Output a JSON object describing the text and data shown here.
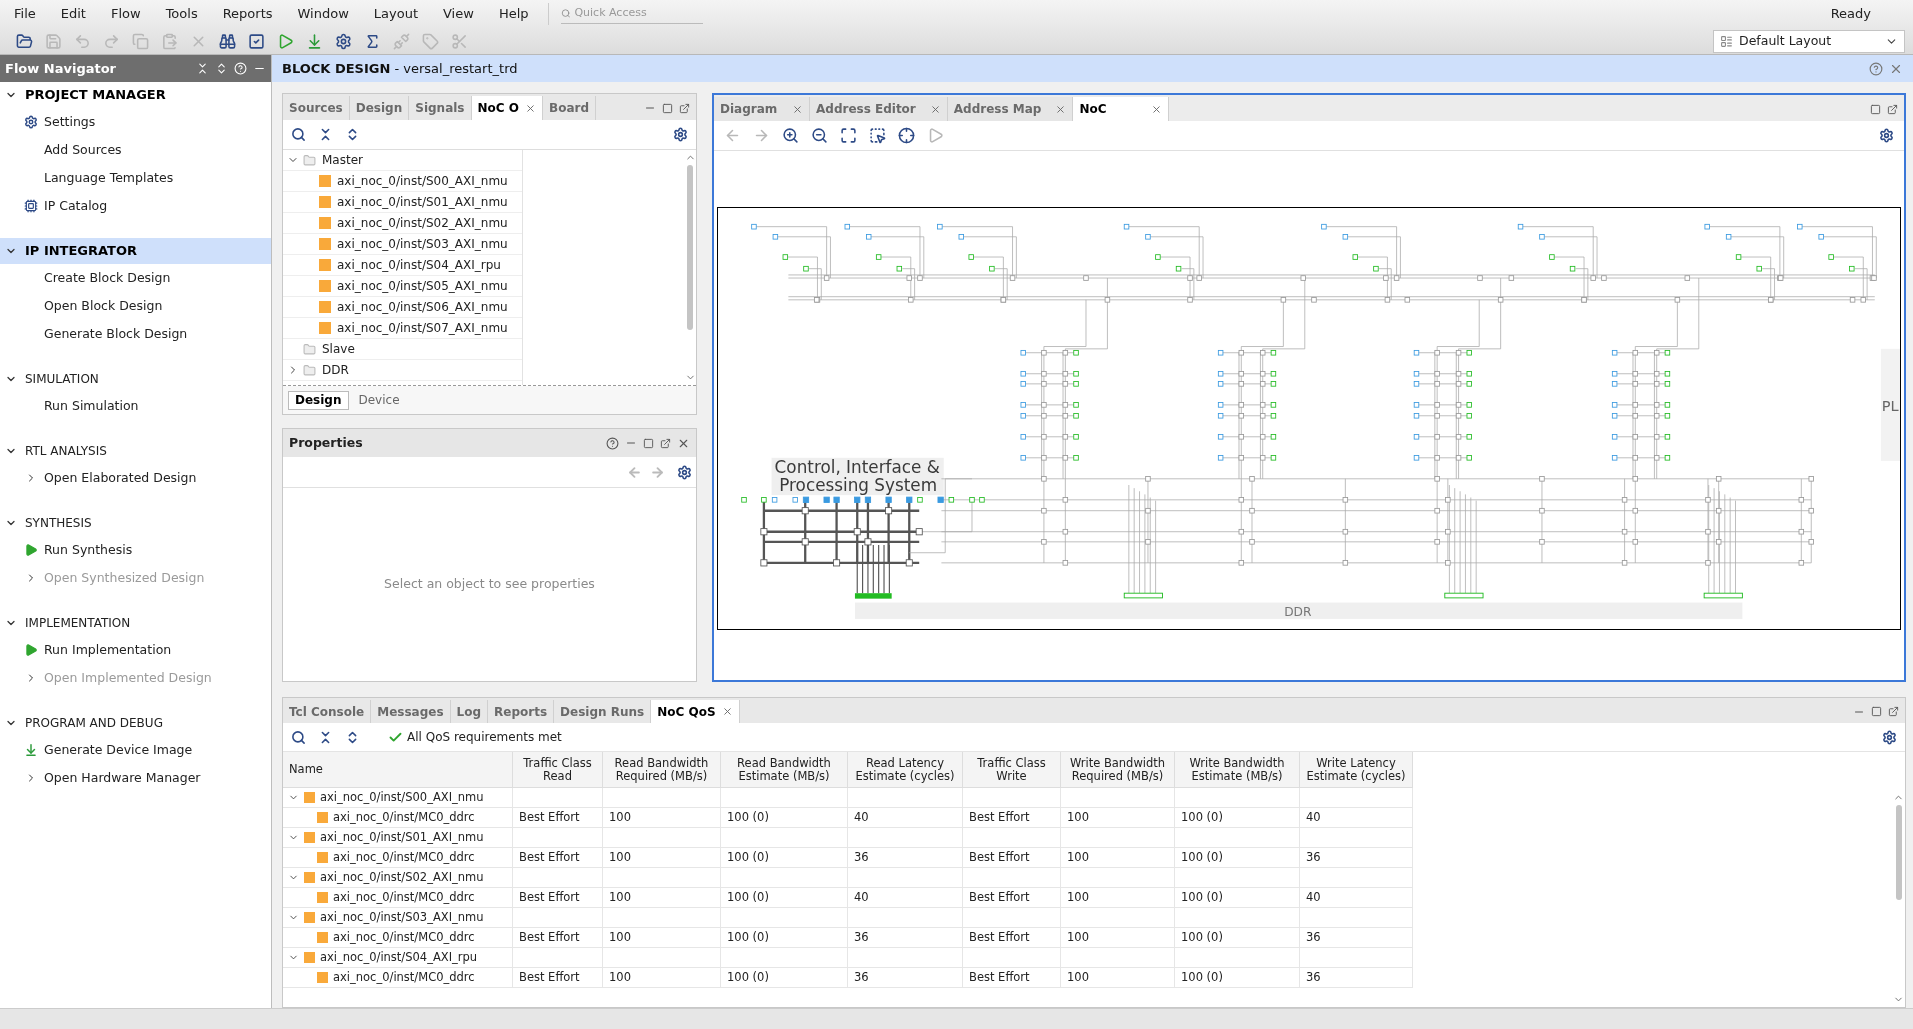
{
  "menu": [
    "File",
    "Edit",
    "Flow",
    "Tools",
    "Reports",
    "Window",
    "Layout",
    "View",
    "Help"
  ],
  "quick_access": {
    "placeholder": "Quick Access"
  },
  "status": "Ready",
  "toolbar": [
    {
      "kind": "open",
      "disabled": false
    },
    {
      "kind": "save",
      "disabled": true
    },
    {
      "kind": "undo",
      "disabled": true
    },
    {
      "kind": "redo",
      "disabled": true
    },
    {
      "kind": "copy",
      "disabled": true
    },
    {
      "kind": "paste",
      "disabled": true
    },
    {
      "kind": "delete",
      "disabled": true
    },
    {
      "kind": "find",
      "disabled": false
    },
    {
      "kind": "check",
      "disabled": false
    },
    {
      "kind": "run",
      "disabled": false
    },
    {
      "kind": "bitstream",
      "disabled": false
    },
    {
      "kind": "settings",
      "disabled": false
    },
    {
      "kind": "sigma",
      "disabled": false
    },
    {
      "kind": "unplug",
      "disabled": true
    },
    {
      "kind": "tag",
      "disabled": true
    },
    {
      "kind": "cut",
      "disabled": true
    }
  ],
  "layout_select": "Default Layout",
  "flow_navigator": {
    "title": "Flow Navigator",
    "sections": [
      {
        "title": "PROJECT MANAGER",
        "kind": "major",
        "selected": false,
        "items": [
          {
            "label": "Settings",
            "kind": "gear",
            "disabled": false
          },
          {
            "label": "Add Sources",
            "kind": "plain",
            "disabled": false
          },
          {
            "label": "Language Templates",
            "kind": "plain",
            "disabled": false
          },
          {
            "label": "IP Catalog",
            "kind": "chip",
            "disabled": false
          }
        ]
      },
      {
        "title": "IP INTEGRATOR",
        "kind": "major",
        "selected": true,
        "items": [
          {
            "label": "Create Block Design",
            "kind": "plain",
            "disabled": false
          },
          {
            "label": "Open Block Design",
            "kind": "plain",
            "disabled": false
          },
          {
            "label": "Generate Block Design",
            "kind": "plain",
            "disabled": false
          }
        ]
      },
      {
        "title": "SIMULATION",
        "kind": "minor",
        "selected": false,
        "items": [
          {
            "label": "Run Simulation",
            "kind": "plain",
            "disabled": false
          }
        ]
      },
      {
        "title": "RTL ANALYSIS",
        "kind": "minor",
        "selected": false,
        "items": [
          {
            "label": "Open Elaborated Design",
            "kind": "expandable",
            "disabled": false
          }
        ]
      },
      {
        "title": "SYNTHESIS",
        "kind": "minor",
        "selected": false,
        "items": [
          {
            "label": "Run Synthesis",
            "kind": "play",
            "disabled": false
          },
          {
            "label": "Open Synthesized Design",
            "kind": "expandable",
            "disabled": true
          }
        ]
      },
      {
        "title": "IMPLEMENTATION",
        "kind": "minor",
        "selected": false,
        "items": [
          {
            "label": "Run Implementation",
            "kind": "play",
            "disabled": false
          },
          {
            "label": "Open Implemented Design",
            "kind": "expandable",
            "disabled": true
          }
        ]
      },
      {
        "title": "PROGRAM AND DEBUG",
        "kind": "minor",
        "selected": false,
        "items": [
          {
            "label": "Generate Device Image",
            "kind": "bitstream",
            "disabled": false
          },
          {
            "label": "Open Hardware Manager",
            "kind": "expandable",
            "disabled": false
          }
        ]
      }
    ]
  },
  "design_header": {
    "title": "BLOCK DESIGN",
    "subtitle": "- versal_restart_trd"
  },
  "sources_panel": {
    "tabs": [
      {
        "label": "Sources",
        "selected": false,
        "closable": false
      },
      {
        "label": "Design",
        "selected": false,
        "closable": false
      },
      {
        "label": "Signals",
        "selected": false,
        "closable": false
      },
      {
        "label": "NoC O",
        "selected": true,
        "closable": true
      },
      {
        "label": "Board",
        "selected": false,
        "closable": false
      }
    ],
    "tree": [
      {
        "label": "Master",
        "expanded": true,
        "children": [
          {
            "label": "axi_noc_0/inst/S00_AXI_nmu"
          },
          {
            "label": "axi_noc_0/inst/S01_AXI_nmu"
          },
          {
            "label": "axi_noc_0/inst/S02_AXI_nmu"
          },
          {
            "label": "axi_noc_0/inst/S03_AXI_nmu"
          },
          {
            "label": "axi_noc_0/inst/S04_AXI_rpu"
          },
          {
            "label": "axi_noc_0/inst/S05_AXI_nmu"
          },
          {
            "label": "axi_noc_0/inst/S06_AXI_nmu"
          },
          {
            "label": "axi_noc_0/inst/S07_AXI_nmu"
          }
        ]
      },
      {
        "label": "Slave"
      },
      {
        "label": "DDR",
        "expanded": false
      }
    ],
    "view_tabs": [
      {
        "label": "Design",
        "selected": true
      },
      {
        "label": "Device",
        "selected": false
      }
    ]
  },
  "properties": {
    "title": "Properties",
    "message": "Select an object to see properties"
  },
  "diagram": {
    "tabs": [
      {
        "label": "Diagram",
        "selected": false
      },
      {
        "label": "Address Editor",
        "selected": false
      },
      {
        "label": "Address Map",
        "selected": false
      },
      {
        "label": "NoC",
        "selected": true
      }
    ],
    "toolbar": [
      {
        "kind": "back",
        "disabled": true
      },
      {
        "kind": "forward",
        "disabled": true
      },
      {
        "kind": "zoom_in",
        "disabled": false
      },
      {
        "kind": "zoom_out",
        "disabled": false
      },
      {
        "kind": "fit",
        "disabled": false
      },
      {
        "kind": "zoom_area",
        "disabled": false
      },
      {
        "kind": "locate",
        "disabled": false
      },
      {
        "kind": "run",
        "disabled": true
      }
    ],
    "labels": [
      {
        "kind": "cips",
        "lines": [
          "Control, Interface &",
          "Processing System"
        ]
      },
      {
        "kind": "ddr",
        "lines": [
          "DDR"
        ]
      },
      {
        "kind": "pl",
        "lines": [
          "PL"
        ]
      }
    ]
  },
  "bottom_panel": {
    "tabs": [
      {
        "label": "Tcl Console",
        "selected": false,
        "closable": false
      },
      {
        "label": "Messages",
        "selected": false,
        "closable": false
      },
      {
        "label": "Log",
        "selected": false,
        "closable": false
      },
      {
        "label": "Reports",
        "selected": false,
        "closable": false
      },
      {
        "label": "Design Runs",
        "selected": false,
        "closable": false
      },
      {
        "label": "NoC QoS",
        "selected": true,
        "closable": true
      }
    ],
    "summary": "All QoS requirements met",
    "table": {
      "columns": [
        [
          "Name"
        ],
        [
          "Traffic Class",
          "Read"
        ],
        [
          "Read Bandwidth",
          "Required (MB/s)"
        ],
        [
          "Read Bandwidth",
          "Estimate (MB/s)"
        ],
        [
          "Read Latency",
          "Estimate (cycles)"
        ],
        [
          "Traffic Class",
          "Write"
        ],
        [
          "Write Bandwidth",
          "Required (MB/s)"
        ],
        [
          "Write Bandwidth",
          "Estimate (MB/s)"
        ],
        [
          "Write Latency",
          "Estimate (cycles)"
        ]
      ],
      "rows": [
        {
          "name": "axi_noc_0/inst/S00_AXI_nmu",
          "expanded": true,
          "children": [
            {
              "name": "axi_noc_0/inst/MC0_ddrc",
              "cells": [
                "Best Effort",
                "100",
                "100 (0)",
                "40",
                "Best Effort",
                "100",
                "100 (0)",
                "40"
              ]
            }
          ]
        },
        {
          "name": "axi_noc_0/inst/S01_AXI_nmu",
          "expanded": true,
          "children": [
            {
              "name": "axi_noc_0/inst/MC0_ddrc",
              "cells": [
                "Best Effort",
                "100",
                "100 (0)",
                "36",
                "Best Effort",
                "100",
                "100 (0)",
                "36"
              ]
            }
          ]
        },
        {
          "name": "axi_noc_0/inst/S02_AXI_nmu",
          "expanded": true,
          "children": [
            {
              "name": "axi_noc_0/inst/MC0_ddrc",
              "cells": [
                "Best Effort",
                "100",
                "100 (0)",
                "40",
                "Best Effort",
                "100",
                "100 (0)",
                "40"
              ]
            }
          ]
        },
        {
          "name": "axi_noc_0/inst/S03_AXI_nmu",
          "expanded": true,
          "children": [
            {
              "name": "axi_noc_0/inst/MC0_ddrc",
              "cells": [
                "Best Effort",
                "100",
                "100 (0)",
                "36",
                "Best Effort",
                "100",
                "100 (0)",
                "36"
              ]
            }
          ]
        },
        {
          "name": "axi_noc_0/inst/S04_AXI_rpu",
          "expanded": true,
          "children": [
            {
              "name": "axi_noc_0/inst/MC0_ddrc",
              "cells": [
                "Best Effort",
                "100",
                "100 (0)",
                "36",
                "Best Effort",
                "100",
                "100 (0)",
                "36"
              ]
            }
          ]
        }
      ]
    }
  }
}
